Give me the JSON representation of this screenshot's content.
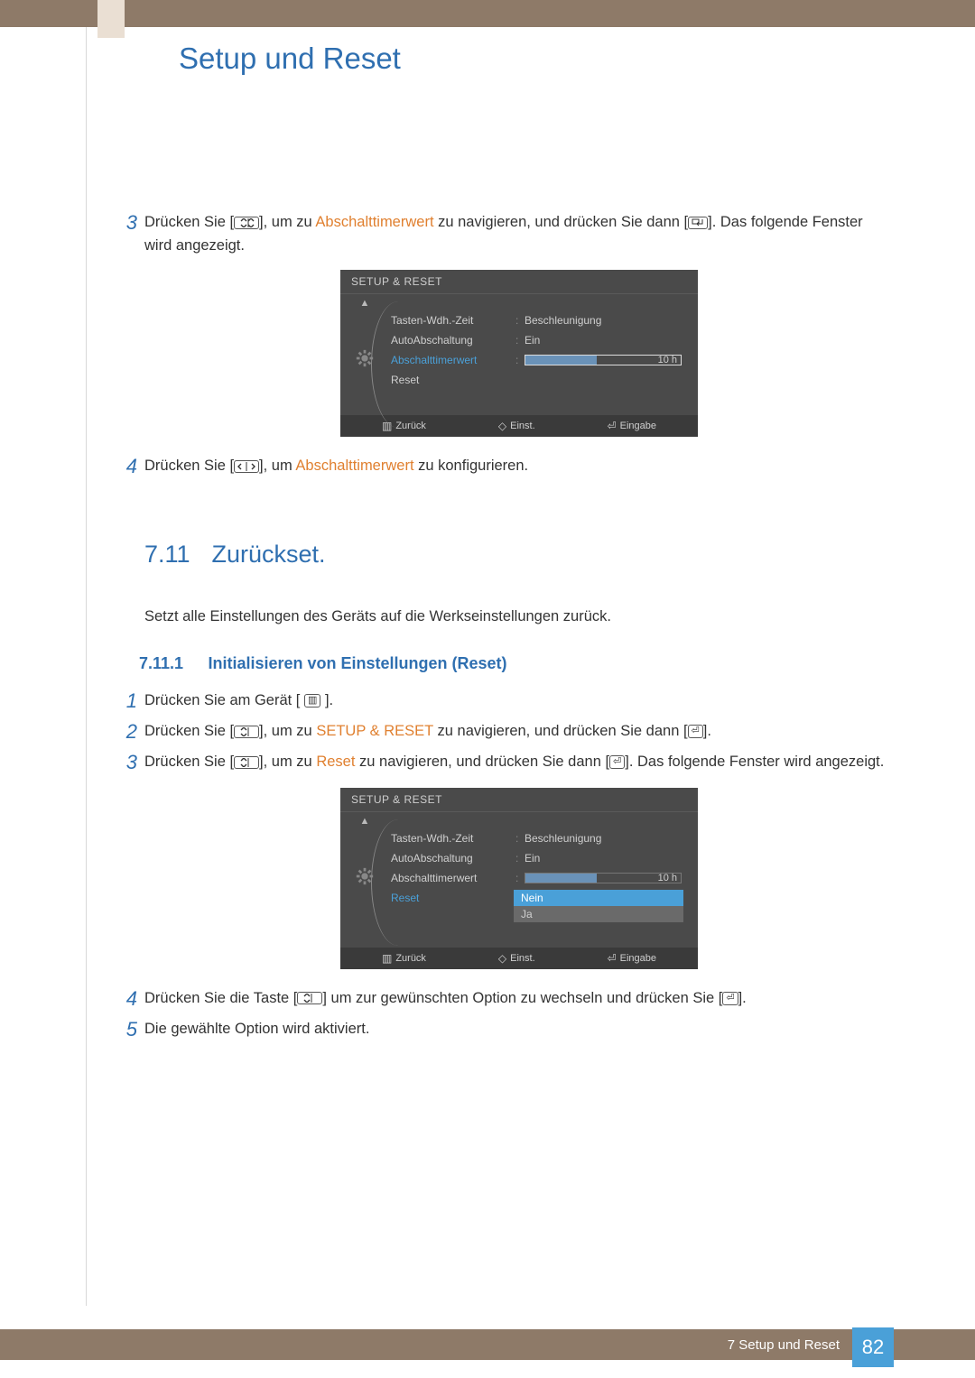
{
  "chapter_title": "Setup und Reset",
  "top_steps": {
    "s3_num": "3",
    "s3_a": "Drücken Sie [",
    "s3_b": "], um zu ",
    "s3_hl": "Abschalttimerwert",
    "s3_c": " zu navigieren, und drücken Sie dann [",
    "s3_d": "]. Das folgende Fenster wird angezeigt.",
    "s4_num": "4",
    "s4_a": "Drücken Sie [",
    "s4_b": "], um ",
    "s4_hl": "Abschalttimerwert",
    "s4_c": " zu konfigurieren."
  },
  "osd1": {
    "header": "SETUP & RESET",
    "items": [
      {
        "label": "Tasten-Wdh.-Zeit",
        "value": "Beschleunigung"
      },
      {
        "label": "AutoAbschaltung",
        "value": "Ein"
      },
      {
        "label": "Abschalttimerwert",
        "slider": "10 h",
        "selected": true
      },
      {
        "label": "Reset"
      }
    ],
    "footer": {
      "back": "Zurück",
      "adjust": "Einst.",
      "enter": "Eingabe"
    }
  },
  "section": {
    "num": "7.11",
    "title": "Zurückset.",
    "desc": "Setzt alle Einstellungen des Geräts auf die Werkseinstellungen zurück."
  },
  "subsection": {
    "num": "7.11.1",
    "title": "Initialisieren von Einstellungen (Reset)"
  },
  "steps2": {
    "s1_num": "1",
    "s1_a": "Drücken Sie am Gerät [ ",
    "s1_b": " ].",
    "s2_num": "2",
    "s2_a": "Drücken Sie [",
    "s2_b": "], um zu ",
    "s2_hl": "SETUP & RESET",
    "s2_c": " zu navigieren, und drücken Sie dann [",
    "s2_d": "].",
    "s3_num": "3",
    "s3_a": "Drücken Sie [",
    "s3_b": "], um zu ",
    "s3_hl": "Reset",
    "s3_c": " zu navigieren, und drücken Sie dann [",
    "s3_d": "]. Das folgende Fenster wird angezeigt.",
    "s4_num": "4",
    "s4_a": "Drücken Sie die Taste [",
    "s4_b": "] um zur gewünschten Option zu wechseln und drücken Sie [",
    "s4_c": "].",
    "s5_num": "5",
    "s5_text": "Die gewählte Option wird aktiviert."
  },
  "osd2": {
    "header": "SETUP & RESET",
    "items": [
      {
        "label": "Tasten-Wdh.-Zeit",
        "value": "Beschleunigung"
      },
      {
        "label": "AutoAbschaltung",
        "value": "Ein"
      },
      {
        "label": "Abschalttimerwert",
        "slider": "10 h"
      },
      {
        "label": "Reset",
        "selected": true,
        "options": [
          "Nein",
          "Ja"
        ],
        "options_sel": 0
      }
    ],
    "footer": {
      "back": "Zurück",
      "adjust": "Einst.",
      "enter": "Eingabe"
    }
  },
  "footer": {
    "chapter": "7 Setup und Reset",
    "page": "82"
  }
}
